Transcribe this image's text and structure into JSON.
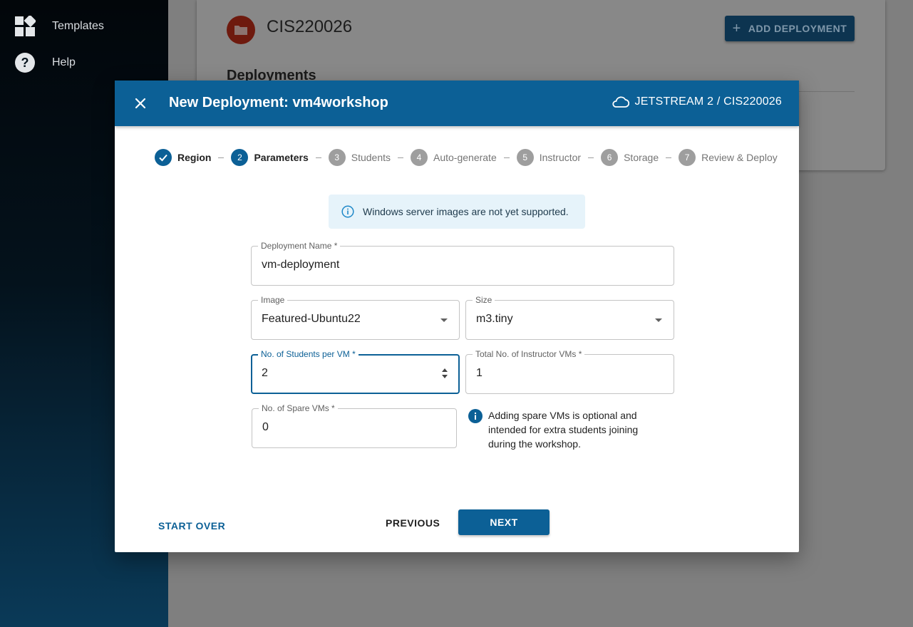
{
  "sidebar": {
    "items": [
      {
        "label": "Templates",
        "icon": "dashboard-icon"
      },
      {
        "label": "Help",
        "icon": "help-icon"
      }
    ]
  },
  "background": {
    "project_title": "CIS220026",
    "add_button_label": "ADD DEPLOYMENT",
    "deployments_heading": "Deployments"
  },
  "dialog": {
    "title": "New Deployment: vm4workshop",
    "context": "JETSTREAM 2 / CIS220026",
    "steps": [
      {
        "num": "",
        "label": "Region",
        "state": "done"
      },
      {
        "num": "2",
        "label": "Parameters",
        "state": "active"
      },
      {
        "num": "3",
        "label": "Students",
        "state": "pending"
      },
      {
        "num": "4",
        "label": "Auto-generate",
        "state": "pending"
      },
      {
        "num": "5",
        "label": "Instructor",
        "state": "pending"
      },
      {
        "num": "6",
        "label": "Storage",
        "state": "pending"
      },
      {
        "num": "7",
        "label": "Review & Deploy",
        "state": "pending"
      }
    ],
    "alert": "Windows server images are not yet supported.",
    "fields": {
      "deployment_name": {
        "label": "Deployment Name *",
        "value": "vm-deployment"
      },
      "image": {
        "label": "Image",
        "value": "Featured-Ubuntu22"
      },
      "size": {
        "label": "Size",
        "value": "m3.tiny"
      },
      "students_per_vm": {
        "label": "No. of Students per VM *",
        "value": "2"
      },
      "instructor_vms": {
        "label": "Total No. of Instructor VMs *",
        "value": "1"
      },
      "spare_vms": {
        "label": "No. of Spare VMs *",
        "value": "0"
      }
    },
    "spare_note": "Adding spare VMs is optional and intended for extra students joining during the workshop.",
    "buttons": {
      "start_over": "START OVER",
      "previous": "PREVIOUS",
      "next": "NEXT"
    }
  },
  "colors": {
    "primary": "#0c6096",
    "alert_bg": "#e6f3fa",
    "step_pending": "#9e9e9e"
  }
}
